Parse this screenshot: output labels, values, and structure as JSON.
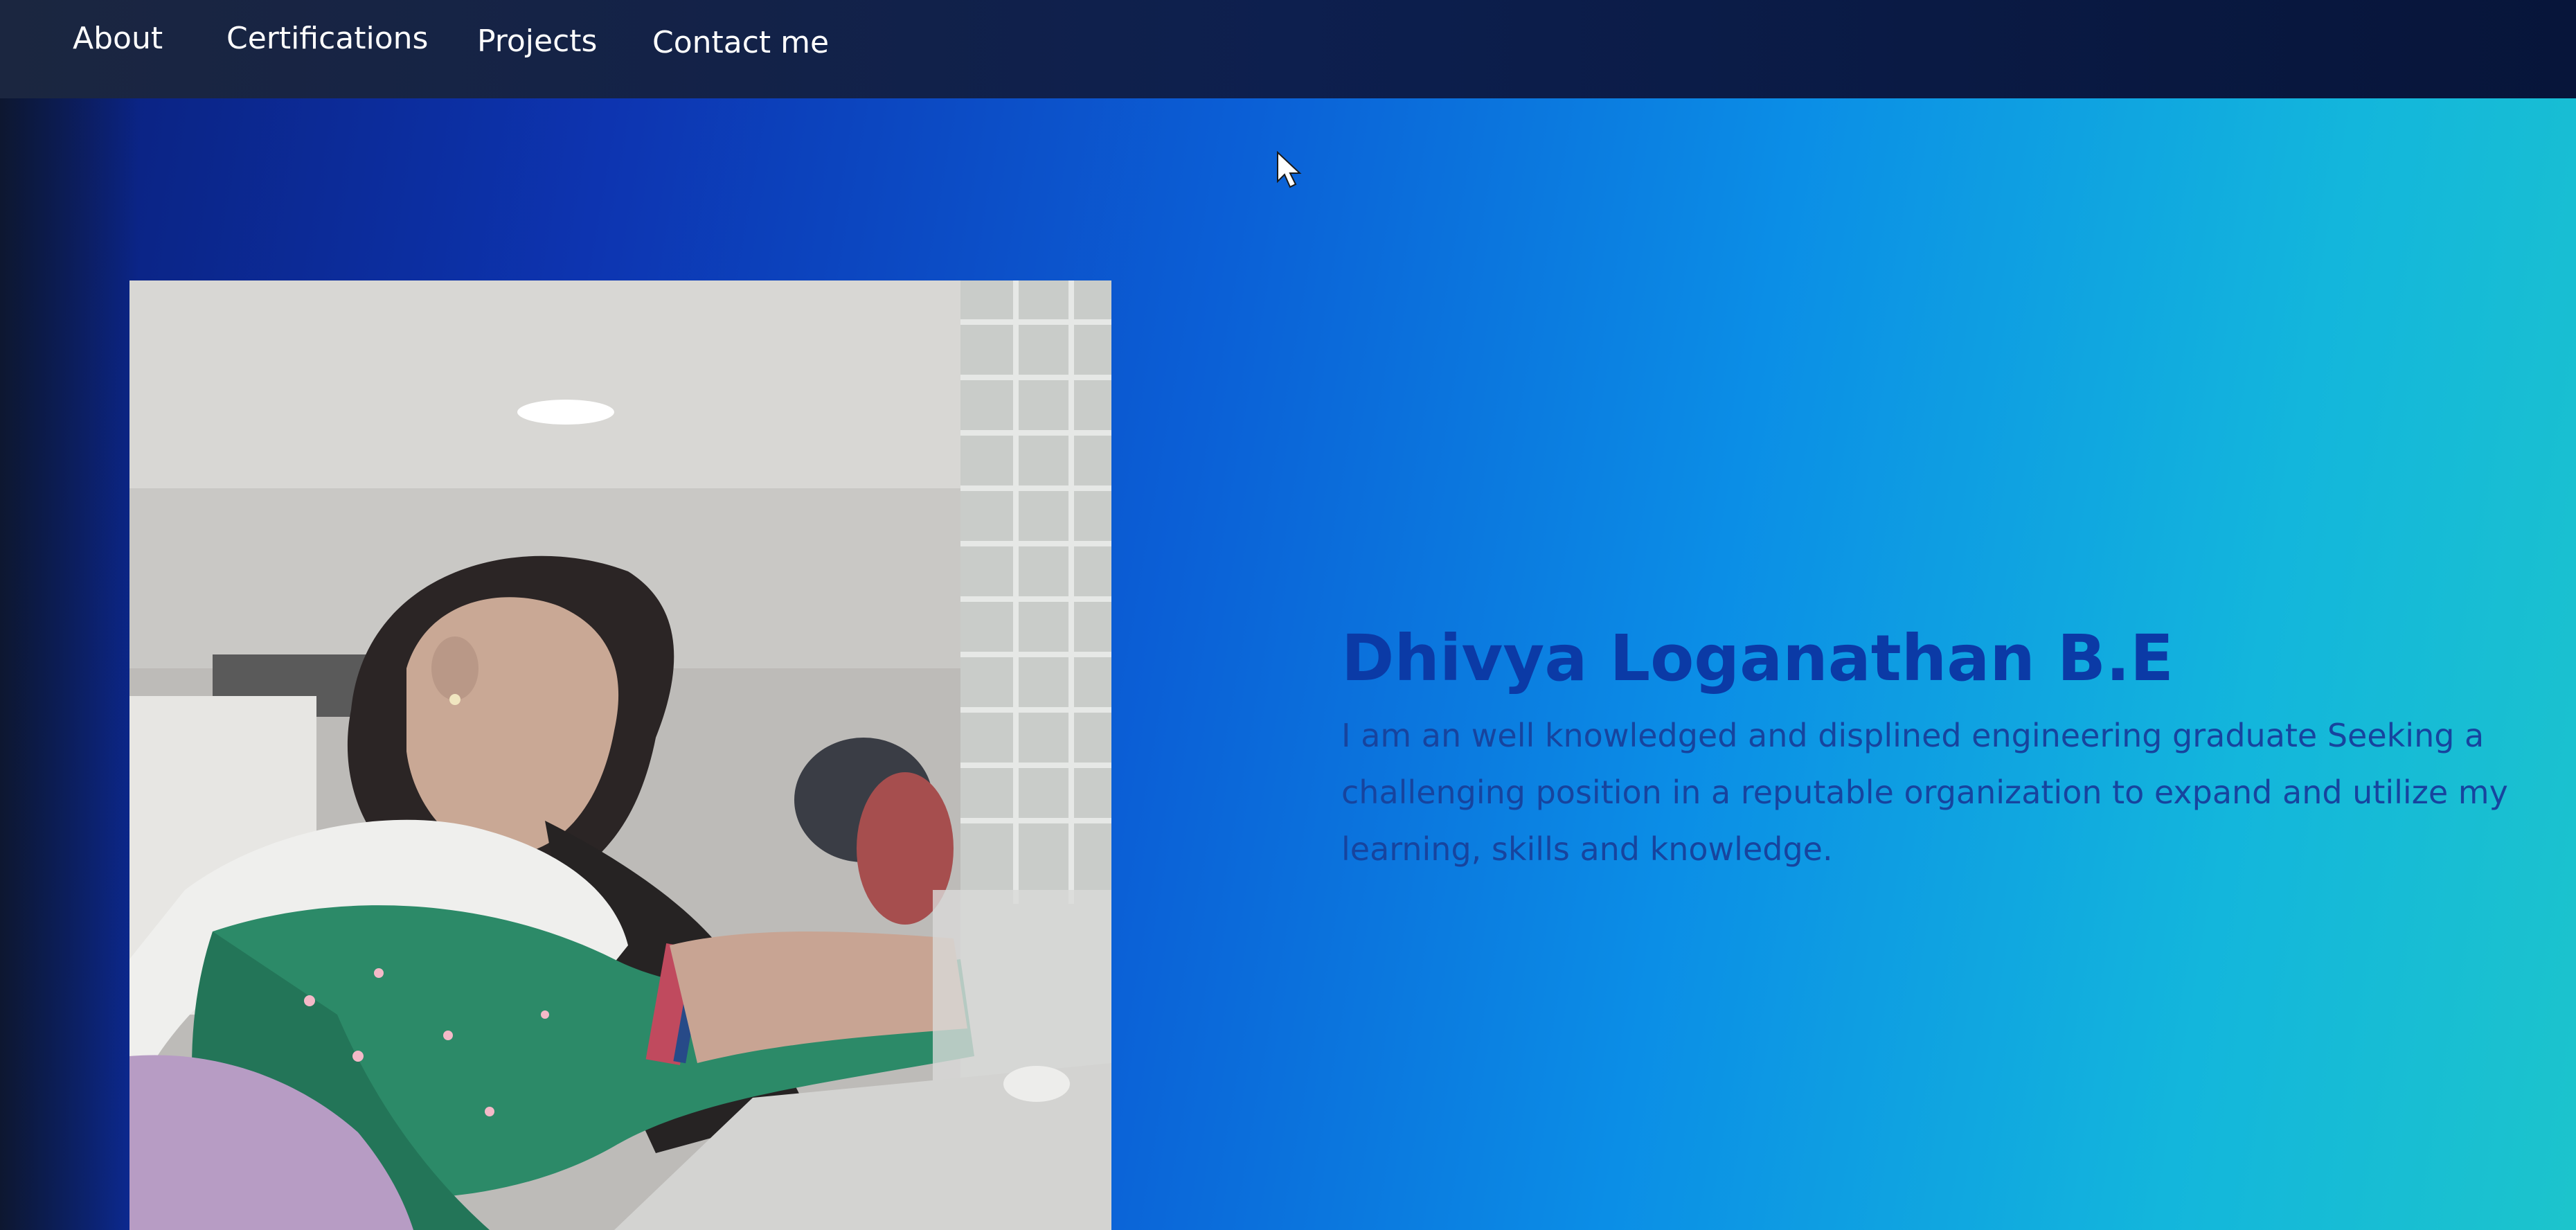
{
  "nav": {
    "items": [
      {
        "label": "About"
      },
      {
        "label": "Certifications"
      },
      {
        "label": "Projects"
      },
      {
        "label": "Contact me"
      }
    ]
  },
  "hero": {
    "name": "Dhivya Loganathan B.E",
    "summary": "I am an well knowledged and displined engineering graduate Seeking a challenging position in a reputable organization to expand and utilize my learning, skills and knowledge."
  },
  "colors": {
    "name_text": "#0b3aa6",
    "summary_text": "#17449e",
    "nav_text": "#ffffff"
  },
  "icons": {
    "cursor": "mouse-pointer-icon"
  }
}
